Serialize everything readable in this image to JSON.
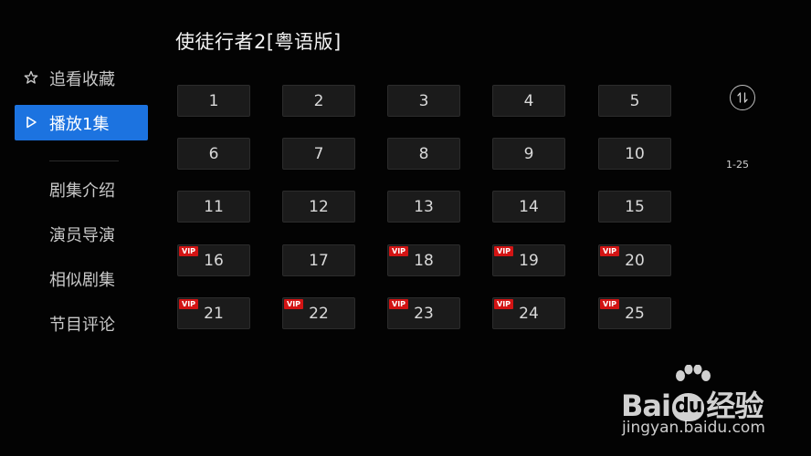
{
  "title": "使徒行者2[粤语版]",
  "sidebar": {
    "items": [
      {
        "label": "追看收藏",
        "icon": "star-outline-icon",
        "active": false
      },
      {
        "label": "播放1集",
        "icon": "play-outline-icon",
        "active": true
      },
      {
        "label": "剧集介绍",
        "icon": "",
        "active": false
      },
      {
        "label": "演员导演",
        "icon": "",
        "active": false
      },
      {
        "label": "相似剧集",
        "icon": "",
        "active": false
      },
      {
        "label": "节目评论",
        "icon": "",
        "active": false
      }
    ]
  },
  "episodes": [
    {
      "label": "1",
      "vip": false
    },
    {
      "label": "2",
      "vip": false
    },
    {
      "label": "3",
      "vip": false
    },
    {
      "label": "4",
      "vip": false
    },
    {
      "label": "5",
      "vip": false
    },
    {
      "label": "6",
      "vip": false
    },
    {
      "label": "7",
      "vip": false
    },
    {
      "label": "8",
      "vip": false
    },
    {
      "label": "9",
      "vip": false
    },
    {
      "label": "10",
      "vip": false
    },
    {
      "label": "11",
      "vip": false
    },
    {
      "label": "12",
      "vip": false
    },
    {
      "label": "13",
      "vip": false
    },
    {
      "label": "14",
      "vip": false
    },
    {
      "label": "15",
      "vip": false
    },
    {
      "label": "16",
      "vip": true
    },
    {
      "label": "17",
      "vip": false
    },
    {
      "label": "18",
      "vip": true
    },
    {
      "label": "19",
      "vip": true
    },
    {
      "label": "20",
      "vip": true
    },
    {
      "label": "21",
      "vip": true
    },
    {
      "label": "22",
      "vip": true
    },
    {
      "label": "23",
      "vip": true
    },
    {
      "label": "24",
      "vip": true
    },
    {
      "label": "25",
      "vip": true
    }
  ],
  "vip_badge": "VIP",
  "sort_button": {
    "icon": "sort-toggle-icon"
  },
  "range_label": "1-25",
  "watermark": {
    "brand_left": "Bai",
    "brand_du": "du",
    "brand_right": "经验",
    "url": "jingyan.baidu.com",
    "icon": "paw-icon"
  },
  "colors": {
    "background": "#030303",
    "accent": "#1c73e0",
    "vip": "#d31414",
    "tile": "#1b1b1b"
  }
}
